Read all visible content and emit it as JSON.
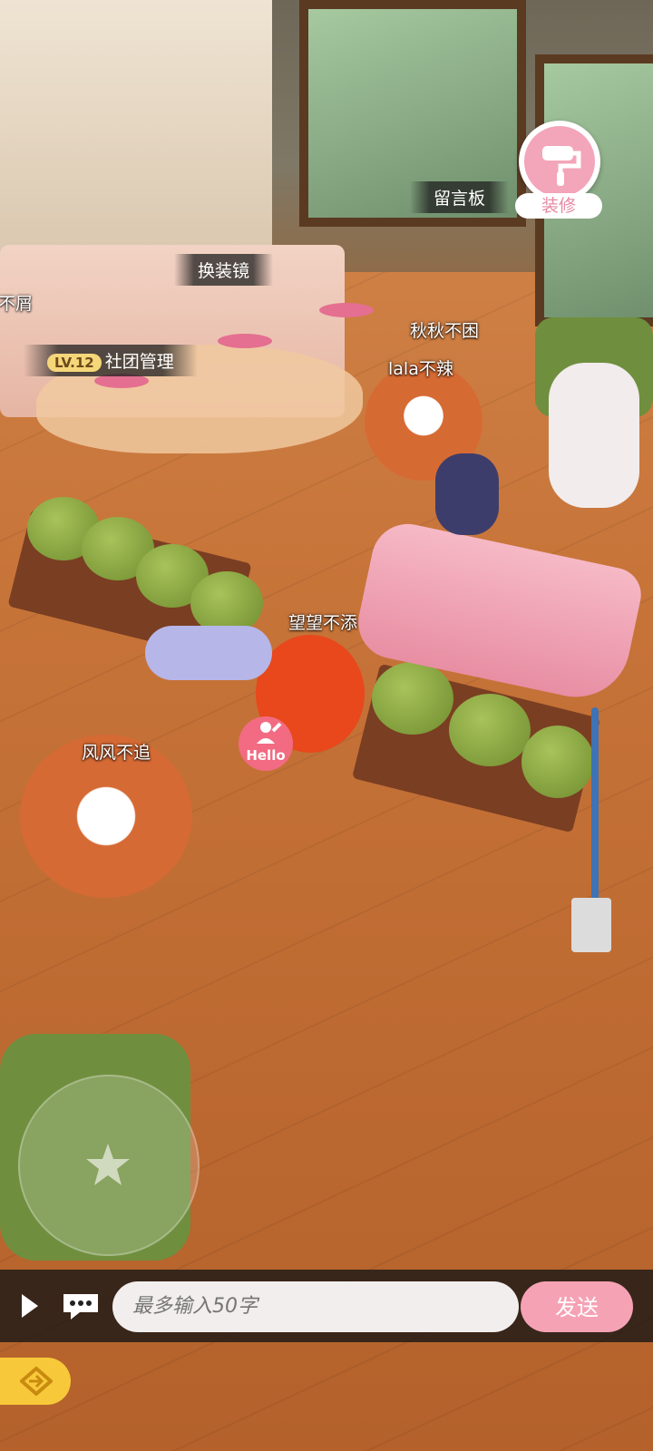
{
  "scene": {
    "labels": {
      "mirror": "换装镜",
      "message_board": "留言板",
      "club_level": "LV.12",
      "club_manage": "社团管理",
      "edge_name": "不屑"
    },
    "players": [
      {
        "name": "秋秋不困"
      },
      {
        "name": "lala不辣"
      },
      {
        "name": "望望不添"
      },
      {
        "name": "风风不追"
      }
    ]
  },
  "hud": {
    "decorate_label": "装修",
    "hello_label": "Hello",
    "joystick_icon": "star-icon",
    "accent_color": "#f6a2b5"
  },
  "chat": {
    "placeholder": "最多输入50字",
    "send_label": "发送"
  }
}
